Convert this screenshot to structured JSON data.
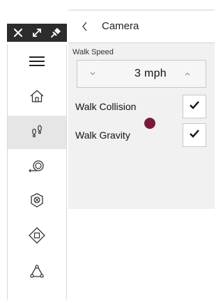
{
  "toolbar": {
    "icons": [
      "close-icon",
      "expand-icon",
      "pin-icon"
    ]
  },
  "nav": {
    "items": [
      {
        "name": "menu",
        "icon": "hamburger-menu-icon",
        "active": false
      },
      {
        "name": "home",
        "icon": "home-icon",
        "active": false
      },
      {
        "name": "walk",
        "icon": "footprints-icon",
        "active": true
      },
      {
        "name": "look-around",
        "icon": "look-around-icon",
        "active": false
      },
      {
        "name": "orbit",
        "icon": "orbit-icon",
        "active": false
      },
      {
        "name": "center",
        "icon": "center-diamond-icon",
        "active": false
      },
      {
        "name": "fly",
        "icon": "fly-icon",
        "active": false
      }
    ]
  },
  "panel": {
    "back_icon": "chevron-left-icon",
    "title": "Camera",
    "walk_speed": {
      "label": "Walk Speed",
      "value": "3 mph",
      "down_icon": "chevron-down-icon",
      "up_icon": "chevron-up-icon"
    },
    "options": [
      {
        "label": "Walk Collision",
        "checked": true
      },
      {
        "label": "Walk Gravity",
        "checked": true
      }
    ]
  },
  "colors": {
    "toolbar_bg": "#2c2c2c",
    "panel_bg": "#f1f1f1",
    "active_nav_bg": "#e6e6e6",
    "cursor_dot": "#7a1a3a"
  }
}
